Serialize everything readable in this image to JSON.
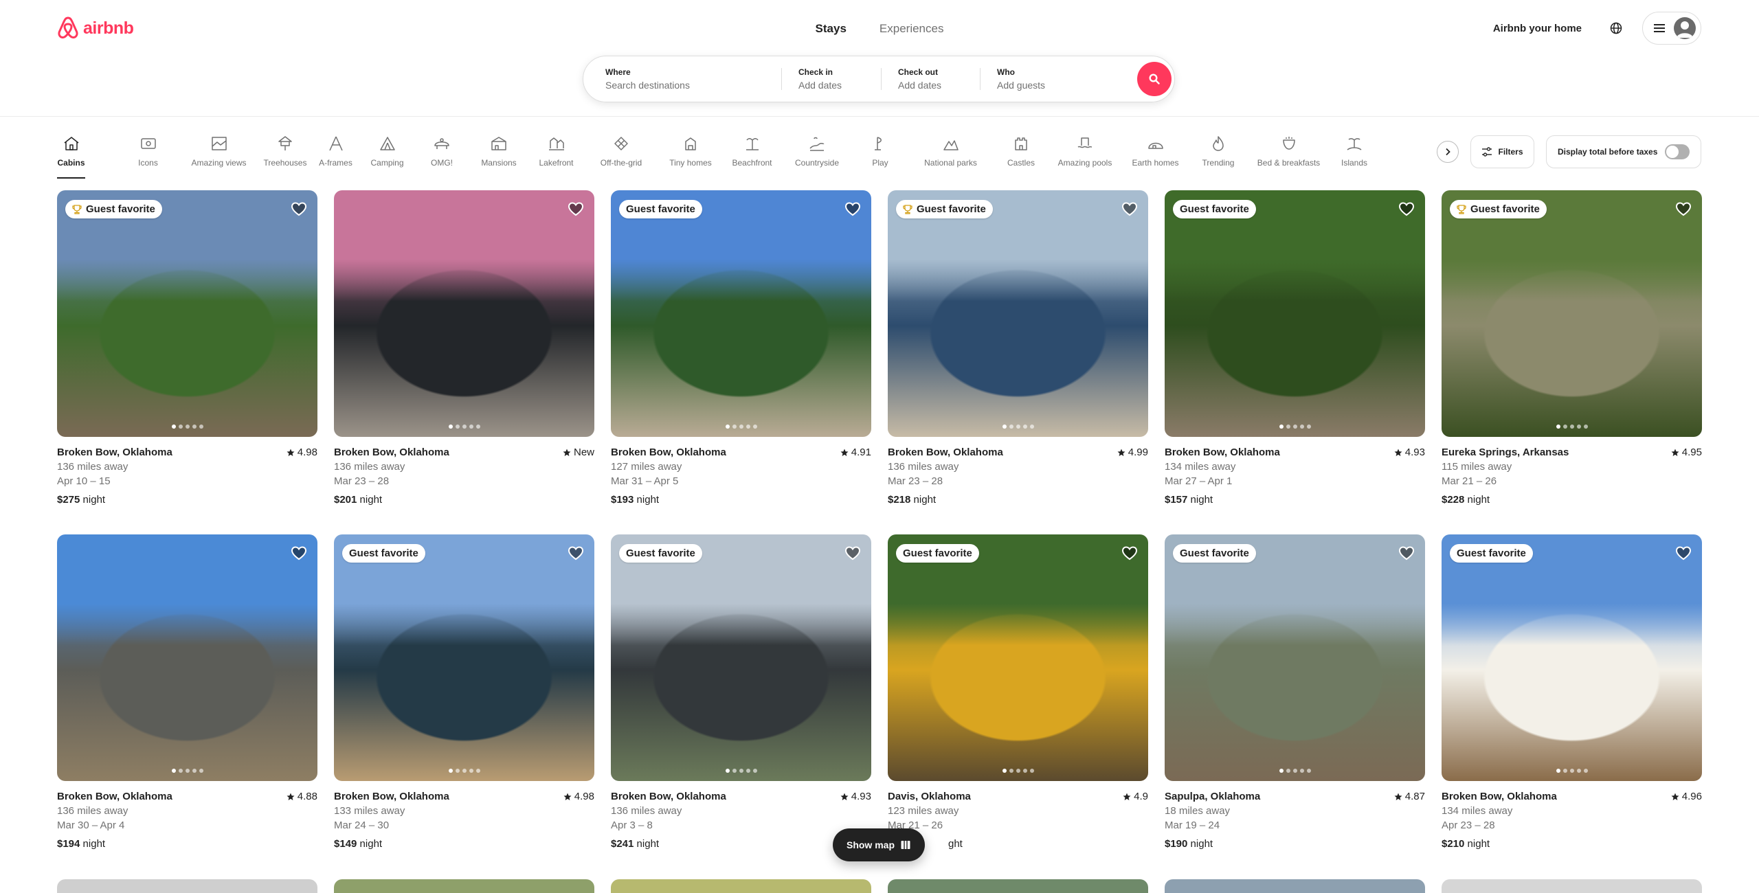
{
  "brand": {
    "name": "airbnb",
    "color": "#ff385c"
  },
  "top_tabs": [
    {
      "label": "Stays",
      "active": true
    },
    {
      "label": "Experiences",
      "active": false
    }
  ],
  "header_right": {
    "host_link": "Airbnb your home",
    "globe_icon": "globe-icon",
    "menu_icon": "hamburger-icon",
    "avatar_icon": "user-avatar-icon"
  },
  "search": {
    "where": {
      "label": "Where",
      "placeholder": "Search destinations"
    },
    "check_in": {
      "label": "Check in",
      "placeholder": "Add dates"
    },
    "check_out": {
      "label": "Check out",
      "placeholder": "Add dates"
    },
    "who": {
      "label": "Who",
      "placeholder": "Add guests"
    },
    "button_icon": "search-icon"
  },
  "categories": [
    {
      "label": "Cabins",
      "icon": "cabin-icon",
      "active": true
    },
    {
      "label": "Icons",
      "icon": "icons-icon"
    },
    {
      "label": "Amazing views",
      "icon": "amazing-views-icon"
    },
    {
      "label": "Treehouses",
      "icon": "treehouse-icon"
    },
    {
      "label": "A-frames",
      "icon": "a-frame-icon"
    },
    {
      "label": "Camping",
      "icon": "camping-icon"
    },
    {
      "label": "OMG!",
      "icon": "omg-icon"
    },
    {
      "label": "Mansions",
      "icon": "mansion-icon"
    },
    {
      "label": "Lakefront",
      "icon": "lakefront-icon"
    },
    {
      "label": "Off-the-grid",
      "icon": "off-the-grid-icon"
    },
    {
      "label": "Tiny homes",
      "icon": "tiny-home-icon"
    },
    {
      "label": "Beachfront",
      "icon": "beachfront-icon"
    },
    {
      "label": "Countryside",
      "icon": "countryside-icon"
    },
    {
      "label": "Play",
      "icon": "play-icon"
    },
    {
      "label": "National parks",
      "icon": "national-park-icon"
    },
    {
      "label": "Castles",
      "icon": "castle-icon"
    },
    {
      "label": "Amazing pools",
      "icon": "pool-icon"
    },
    {
      "label": "Earth homes",
      "icon": "earth-home-icon"
    },
    {
      "label": "Trending",
      "icon": "trending-icon"
    },
    {
      "label": "Bed & breakfasts",
      "icon": "bed-breakfast-icon"
    },
    {
      "label": "Islands",
      "icon": "island-icon"
    }
  ],
  "filters": {
    "label": "Filters",
    "icon": "filters-icon"
  },
  "tax_toggle": {
    "label": "Display total before taxes",
    "on": false
  },
  "listings": [
    {
      "location": "Broken Bow, Oklahoma",
      "rating": "4.98",
      "distance": "136 miles away",
      "dates": "Apr 10 – 15",
      "price": "$275",
      "price_unit": "night",
      "badge": "Guest favorite",
      "trophy": true,
      "palette": [
        "#6b8bb5",
        "#3e6b2c",
        "#7a6a55"
      ]
    },
    {
      "location": "Broken Bow, Oklahoma",
      "rating": "New",
      "distance": "136 miles away",
      "dates": "Mar 23 – 28",
      "price": "$201",
      "price_unit": "night",
      "badge": "",
      "trophy": false,
      "palette": [
        "#c8759a",
        "#23262a",
        "#9b9389"
      ]
    },
    {
      "location": "Broken Bow, Oklahoma",
      "rating": "4.91",
      "distance": "127 miles away",
      "dates": "Mar 31 – Apr 5",
      "price": "$193",
      "price_unit": "night",
      "badge": "Guest favorite",
      "trophy": false,
      "palette": [
        "#4f86d4",
        "#2f5a2a",
        "#b9ab95"
      ]
    },
    {
      "location": "Broken Bow, Oklahoma",
      "rating": "4.99",
      "distance": "136 miles away",
      "dates": "Mar 23 – 28",
      "price": "$218",
      "price_unit": "night",
      "badge": "Guest favorite",
      "trophy": true,
      "palette": [
        "#a7bccf",
        "#2d4c6e",
        "#c7bba6"
      ]
    },
    {
      "location": "Broken Bow, Oklahoma",
      "rating": "4.93",
      "distance": "134 miles away",
      "dates": "Mar 27 – Apr 1",
      "price": "$157",
      "price_unit": "night",
      "badge": "Guest favorite",
      "trophy": false,
      "palette": [
        "#3f6b2a",
        "#2e4d1e",
        "#8a7b68"
      ]
    },
    {
      "location": "Eureka Springs, Arkansas",
      "rating": "4.95",
      "distance": "115 miles away",
      "dates": "Mar 21 – 26",
      "price": "$228",
      "price_unit": "night",
      "badge": "Guest favorite",
      "trophy": true,
      "palette": [
        "#5b7a3a",
        "#8c8a6c",
        "#3b5022"
      ]
    },
    {
      "location": "Broken Bow, Oklahoma",
      "rating": "4.88",
      "distance": "136 miles away",
      "dates": "Mar 30 – Apr 4",
      "price": "$194",
      "price_unit": "night",
      "badge": "",
      "trophy": false,
      "palette": [
        "#4b8ad6",
        "#5c5d58",
        "#8e7e63"
      ]
    },
    {
      "location": "Broken Bow, Oklahoma",
      "rating": "4.98",
      "distance": "133 miles away",
      "dates": "Mar 24 – 30",
      "price": "$149",
      "price_unit": "night",
      "badge": "Guest favorite",
      "trophy": false,
      "palette": [
        "#7ba4d8",
        "#243a47",
        "#b99c72"
      ]
    },
    {
      "location": "Broken Bow, Oklahoma",
      "rating": "4.93",
      "distance": "136 miles away",
      "dates": "Apr 3 – 8",
      "price": "$241",
      "price_unit": "night",
      "badge": "Guest favorite",
      "trophy": false,
      "palette": [
        "#b7c3cf",
        "#33383b",
        "#6b7a5a"
      ]
    },
    {
      "location": "Davis, Oklahoma",
      "rating": "4.9",
      "distance": "123 miles away",
      "dates": "Mar 21 – 26",
      "price": "",
      "price_unit": "ght",
      "badge": "Guest favorite",
      "trophy": false,
      "palette": [
        "#3e6a2c",
        "#d9a520",
        "#5b4a2e"
      ]
    },
    {
      "location": "Sapulpa, Oklahoma",
      "rating": "4.87",
      "distance": "18 miles away",
      "dates": "Mar 19 – 24",
      "price": "$190",
      "price_unit": "night",
      "badge": "Guest favorite",
      "trophy": false,
      "palette": [
        "#9fb2c2",
        "#6f7a62",
        "#7b6a55"
      ]
    },
    {
      "location": "Broken Bow, Oklahoma",
      "rating": "4.96",
      "distance": "134 miles away",
      "dates": "Apr 23 – 28",
      "price": "$210",
      "price_unit": "night",
      "badge": "Guest favorite",
      "trophy": false,
      "palette": [
        "#5a90d6",
        "#f3f0e8",
        "#8a6c4a"
      ]
    }
  ],
  "partial_row_colors": [
    "#cfcfcf",
    "#8ea06a",
    "#b7b96f",
    "#6f8a6a",
    "#8da0b0",
    "#d6d6d6"
  ],
  "show_map": {
    "label": "Show map",
    "icon": "map-icon"
  }
}
